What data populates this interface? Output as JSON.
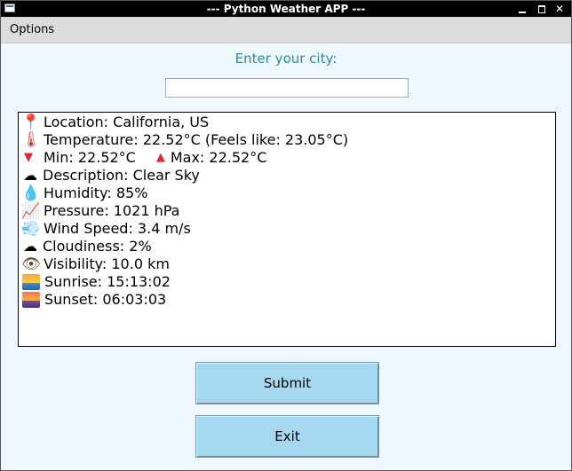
{
  "window": {
    "title": "--- Python Weather APP ---",
    "minimize_glyph": "",
    "maximize_glyph": "",
    "close_glyph": "✕"
  },
  "menubar": {
    "options_label": "Options"
  },
  "form": {
    "prompt": "Enter your city:",
    "city_value": "",
    "submit_label": "Submit",
    "exit_label": "Exit"
  },
  "weather": {
    "location": "Location: California, US",
    "temperature": "Temperature: 22.52°C (Feels like: 23.05°C)",
    "min": "Min: 22.52°C",
    "max": "Max: 22.52°C",
    "description": "Description: Clear Sky",
    "humidity": "Humidity: 85%",
    "pressure": "Pressure: 1021 hPa",
    "wind": "Wind Speed: 3.4 m/s",
    "cloudiness": "Cloudiness: 2%",
    "visibility": "Visibility: 10.0 km",
    "sunrise": "Sunrise: 15:13:02",
    "sunset": "Sunset: 06:03:03"
  },
  "icons": {
    "location": "location-pin-icon",
    "temperature": "thermometer-icon",
    "min": "down-triangle-icon",
    "max": "up-triangle-icon",
    "description": "cloud-icon",
    "humidity": "droplet-icon",
    "pressure": "chart-increasing-icon",
    "wind": "wind-icon",
    "cloudiness": "cloud-icon",
    "visibility": "eye-icon",
    "sunrise": "sunrise-icon",
    "sunset": "sunset-icon"
  },
  "colors": {
    "window_bg": "#f0f8ff",
    "prompt_text": "#2a8c9c",
    "button_bg": "#a6d9ef",
    "titlebar_bg": "#000000"
  }
}
